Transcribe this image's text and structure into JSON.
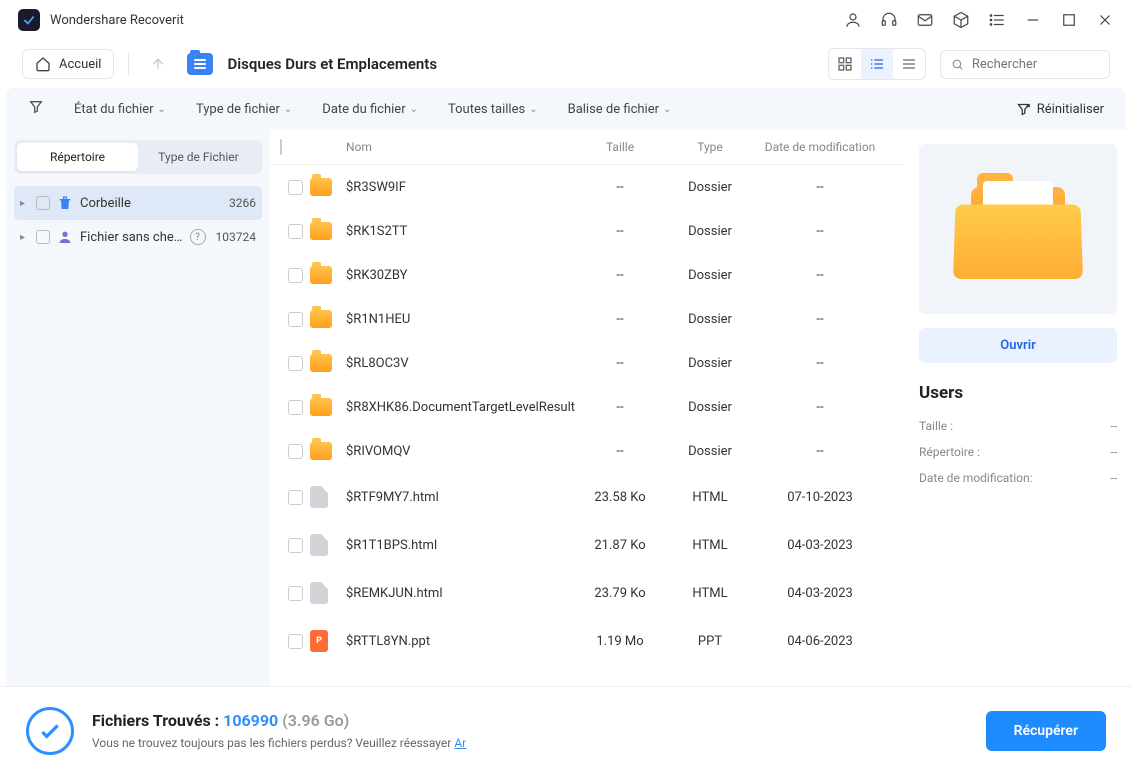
{
  "app": {
    "title": "Wondershare Recoverit"
  },
  "toolbar": {
    "home": "Accueil",
    "breadcrumb": "Disques Durs et Emplacements",
    "search_placeholder": "Rechercher"
  },
  "filters": {
    "state": "État du fichier",
    "type": "Type de fichier",
    "date": "Date du fichier",
    "size": "Toutes tailles",
    "tag": "Balise de fichier",
    "reset": "Réinitialiser"
  },
  "sidebar": {
    "tab_dir": "Répertoire",
    "tab_type": "Type de Fichier",
    "items": [
      {
        "label": "Corbeille",
        "count": "3266"
      },
      {
        "label": "Fichier sans che...",
        "count": "103724"
      }
    ]
  },
  "columns": {
    "name": "Nom",
    "size": "Taille",
    "type": "Type",
    "date": "Date de modification"
  },
  "files": [
    {
      "name": "$R3SW9IF",
      "size": "--",
      "type": "Dossier",
      "date": "--",
      "kind": "folder"
    },
    {
      "name": "$RK1S2TT",
      "size": "--",
      "type": "Dossier",
      "date": "--",
      "kind": "folder"
    },
    {
      "name": "$RK30ZBY",
      "size": "--",
      "type": "Dossier",
      "date": "--",
      "kind": "folder"
    },
    {
      "name": "$R1N1HEU",
      "size": "--",
      "type": "Dossier",
      "date": "--",
      "kind": "folder"
    },
    {
      "name": "$RL8OC3V",
      "size": "--",
      "type": "Dossier",
      "date": "--",
      "kind": "folder"
    },
    {
      "name": "$R8XHK86.DocumentTargetLevelResult",
      "size": "--",
      "type": "Dossier",
      "date": "--",
      "kind": "folder"
    },
    {
      "name": "$RIVOMQV",
      "size": "--",
      "type": "Dossier",
      "date": "--",
      "kind": "folder"
    },
    {
      "name": "$RTF9MY7.html",
      "size": "23.58 Ko",
      "type": "HTML",
      "date": "07-10-2023",
      "kind": "file"
    },
    {
      "name": "$R1T1BPS.html",
      "size": "21.87 Ko",
      "type": "HTML",
      "date": "04-03-2023",
      "kind": "file"
    },
    {
      "name": "$REMKJUN.html",
      "size": "23.79 Ko",
      "type": "HTML",
      "date": "04-03-2023",
      "kind": "file"
    },
    {
      "name": "$RTTL8YN.ppt",
      "size": "1.19 Mo",
      "type": "PPT",
      "date": "04-06-2023",
      "kind": "ppt"
    }
  ],
  "preview": {
    "open": "Ouvrir",
    "title": "Users",
    "meta": [
      {
        "label": "Taille :",
        "value": "--"
      },
      {
        "label": "Répertoire :",
        "value": "--"
      },
      {
        "label": "Date de modification:",
        "value": "--"
      }
    ]
  },
  "footer": {
    "found_label": "Fichiers Trouvés : ",
    "found_count": "106990",
    "found_size": " (3.96 Go)",
    "sub_text": "Vous ne trouvez toujours pas les fichiers perdus? Veuillez réessayer ",
    "sub_link": "Ar",
    "recover": "Récupérer"
  }
}
